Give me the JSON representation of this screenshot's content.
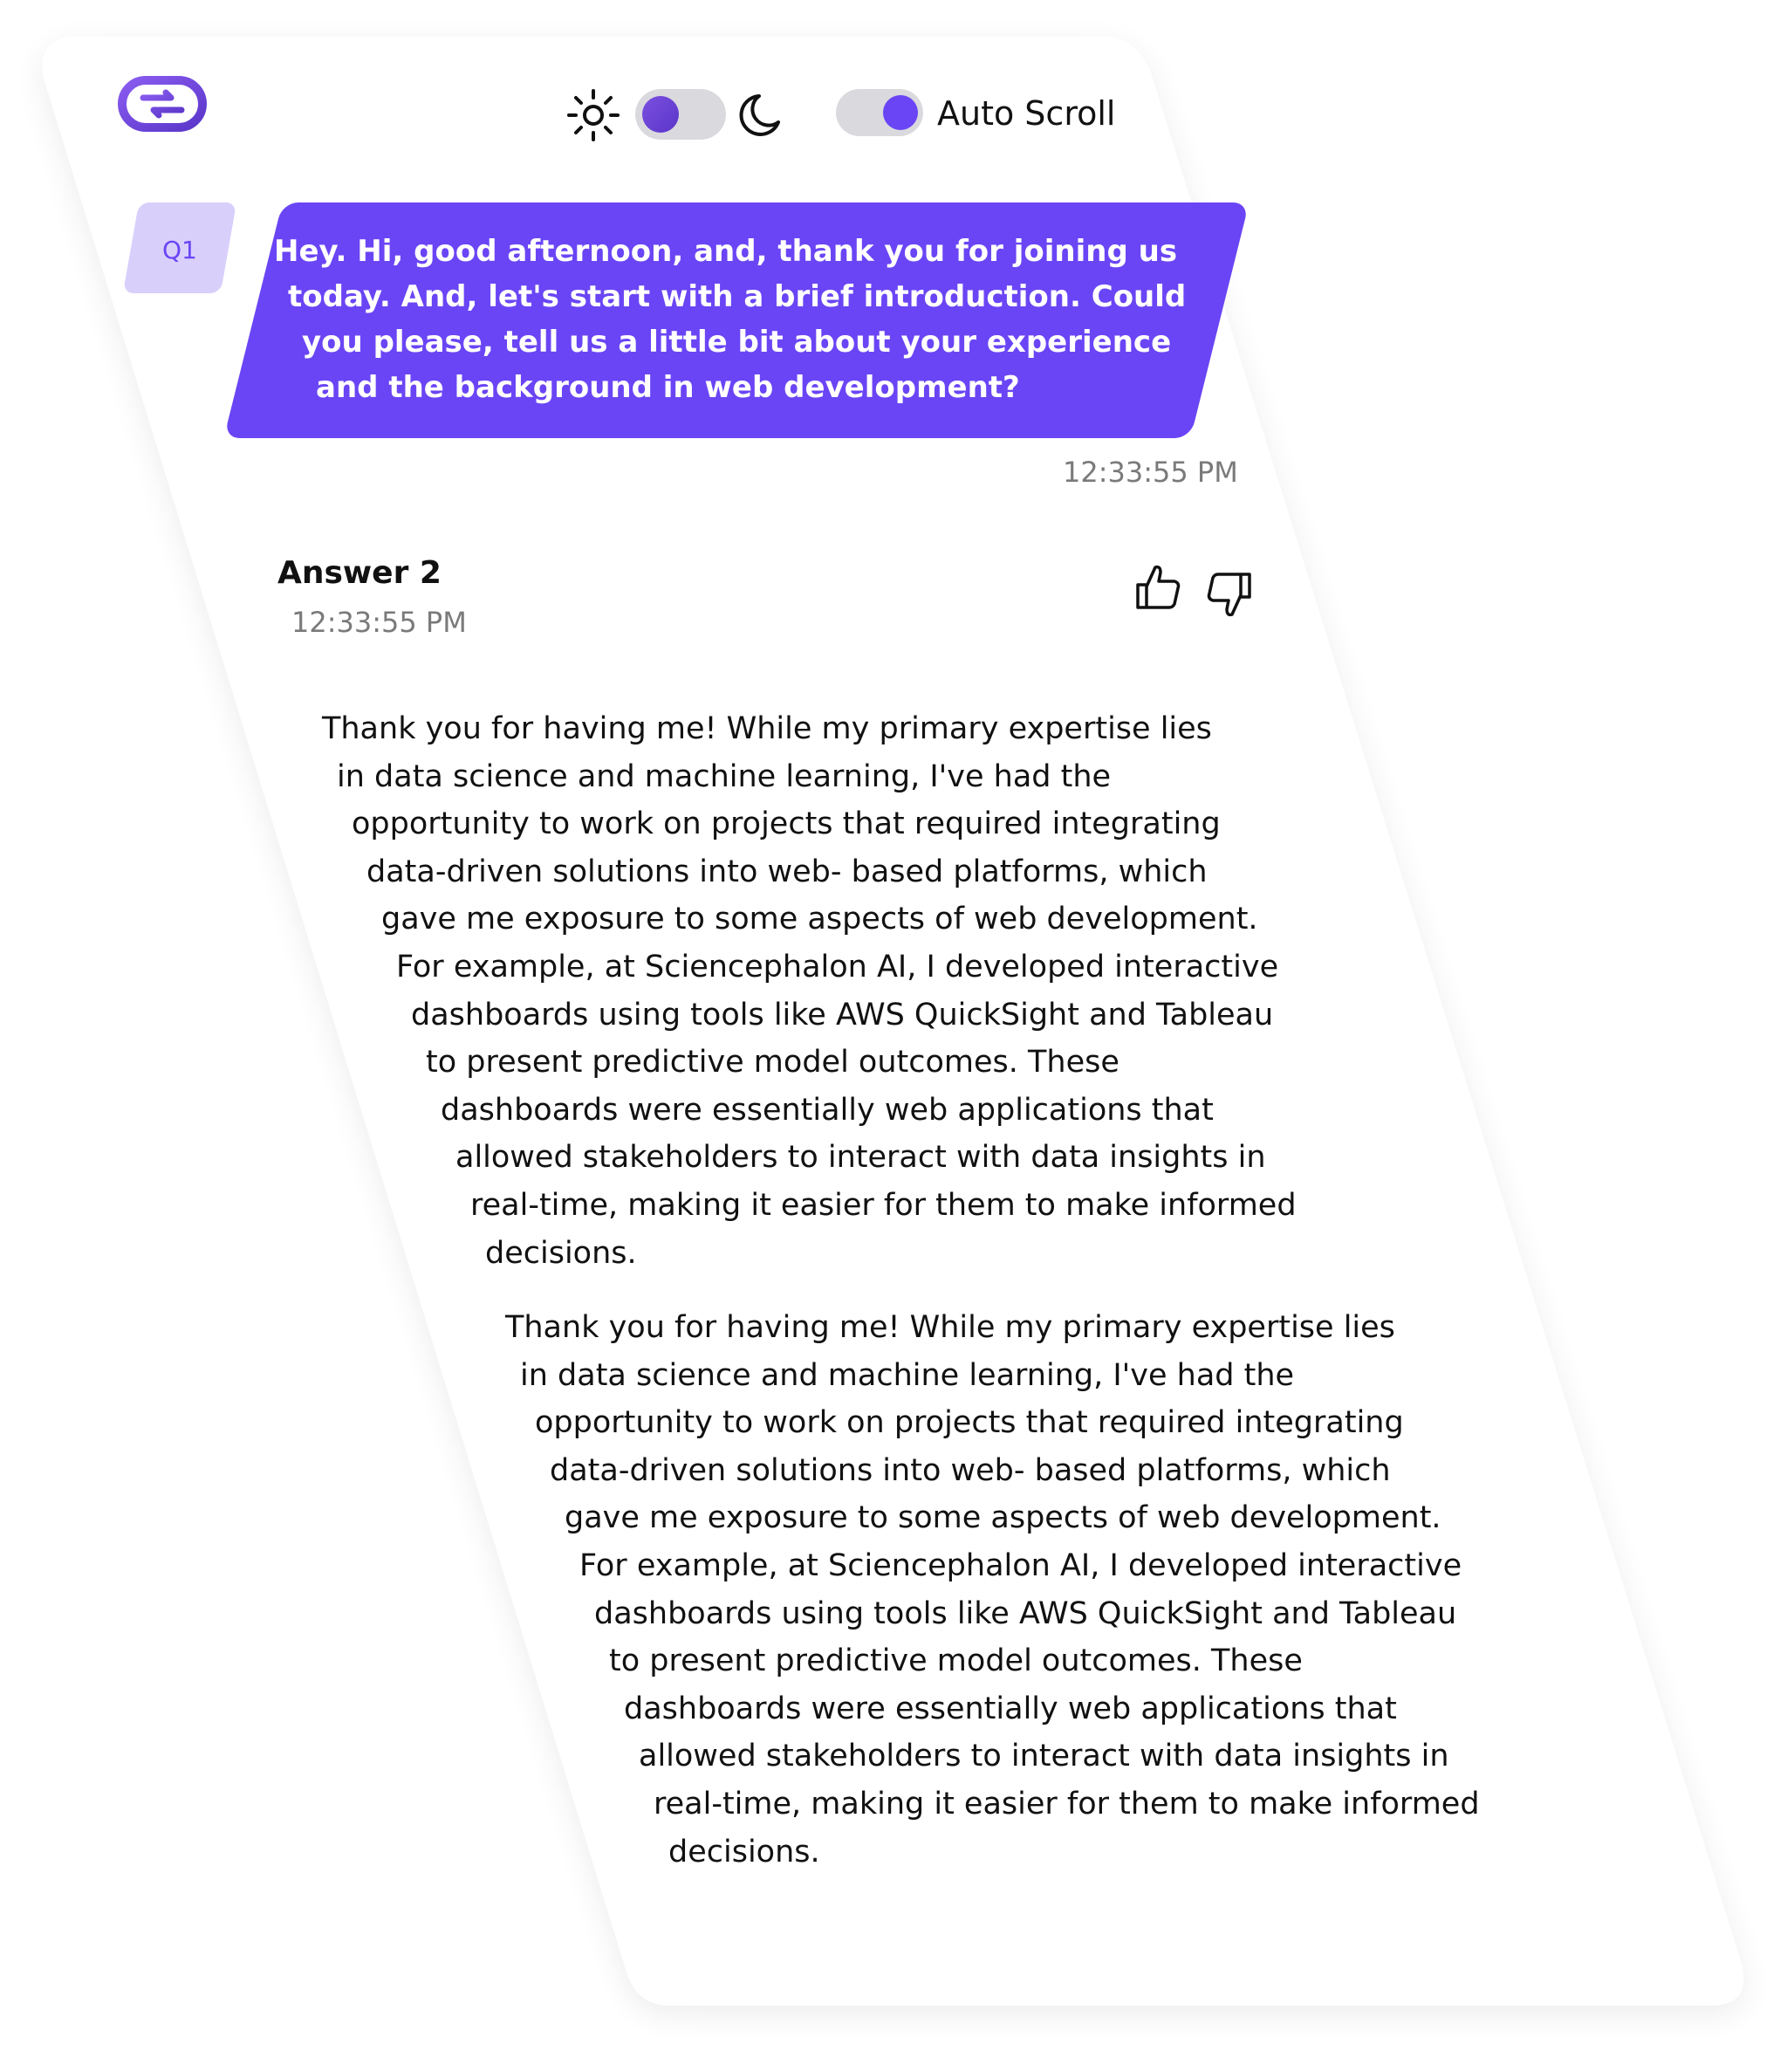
{
  "header": {
    "logo_icon": "chat-logo-icon",
    "theme_toggle": {
      "left_icon": "sun-icon",
      "right_icon": "moon-icon"
    },
    "autoscroll_label": "Auto Scroll"
  },
  "question": {
    "tag": "Q1",
    "lines": [
      "Hey. Hi, good afternoon, and, thank you for joining us",
      "today. And, let's start with a brief introduction. Could",
      "you please, tell us a little bit about your experience",
      "and the background in web development?"
    ],
    "time": "12:33:55 PM"
  },
  "answer": {
    "title": "Answer 2",
    "time": "12:33:55 PM",
    "paragraphs": [
      {
        "lines": [
          "Thank you for having me! While my primary expertise lies",
          "in data science and machine learning, I've had the",
          "opportunity to work on projects that required integrating",
          "data-driven solutions into web- based platforms, which",
          "gave me exposure to some aspects of web development.",
          "For example, at Sciencephalon AI, I developed interactive",
          "dashboards using tools like AWS QuickSight and Tableau",
          "to present predictive model outcomes. These",
          "dashboards were essentially web applications that",
          "allowed stakeholders to interact with data insights in",
          "real-time, making it easier for them to make informed",
          "decisions."
        ]
      },
      {
        "lines": [
          "Thank you for having me! While my primary expertise lies",
          "in data science and machine learning, I've had the",
          "opportunity to work on projects that required integrating",
          "data-driven solutions into web- based platforms, which",
          "gave me exposure to some aspects of web development.",
          "For example, at Sciencephalon AI, I developed interactive",
          "dashboards using tools like AWS QuickSight and Tableau",
          "to present predictive model outcomes. These",
          "dashboards were essentially web applications that",
          "allowed stakeholders to interact with data insights in",
          "real-time, making it easier for them to make informed",
          "decisions."
        ]
      }
    ]
  },
  "colors": {
    "accent": "#6a45f5",
    "accent_light": "#d9cffb",
    "text": "#111111",
    "muted": "#7a7a7a"
  }
}
